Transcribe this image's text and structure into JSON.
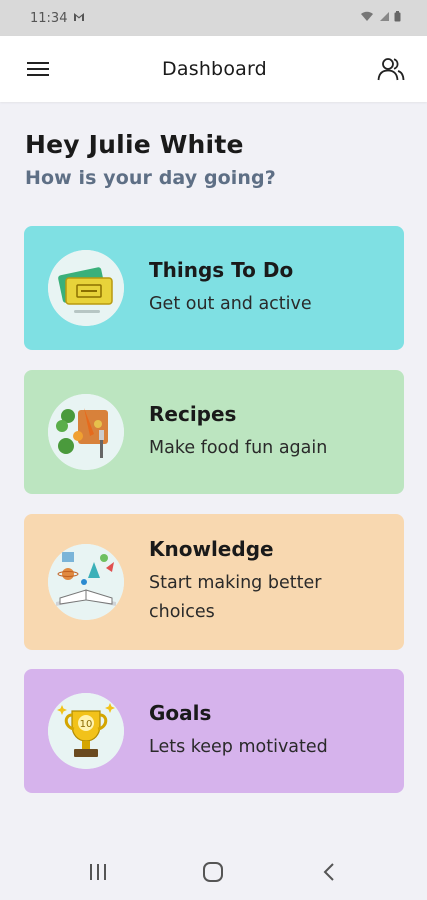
{
  "status": {
    "time": "11:34",
    "notif_icon": "gmail-icon"
  },
  "app_bar": {
    "title": "Dashboard",
    "menu_icon": "hamburger-menu-icon",
    "profile_icon": "users-icon"
  },
  "greeting": {
    "title": "Hey Julie White",
    "subtitle": "How is your day going?"
  },
  "cards": [
    {
      "title": "Things To Do",
      "subtitle": "Get out and active",
      "color": "#7fe0e3",
      "icon": "tickets-icon"
    },
    {
      "title": "Recipes",
      "subtitle": "Make food fun again",
      "color": "#bce5c0",
      "icon": "vegetables-icon"
    },
    {
      "title": "Knowledge",
      "subtitle": "Start making better choices",
      "color": "#f8d8b0",
      "icon": "book-icon"
    },
    {
      "title": "Goals",
      "subtitle": "Lets keep motivated",
      "color": "#d6b3ec",
      "icon": "trophy-icon"
    }
  ],
  "nav": {
    "recents_icon": "recents-icon",
    "home_icon": "home-icon",
    "back_icon": "back-icon"
  }
}
